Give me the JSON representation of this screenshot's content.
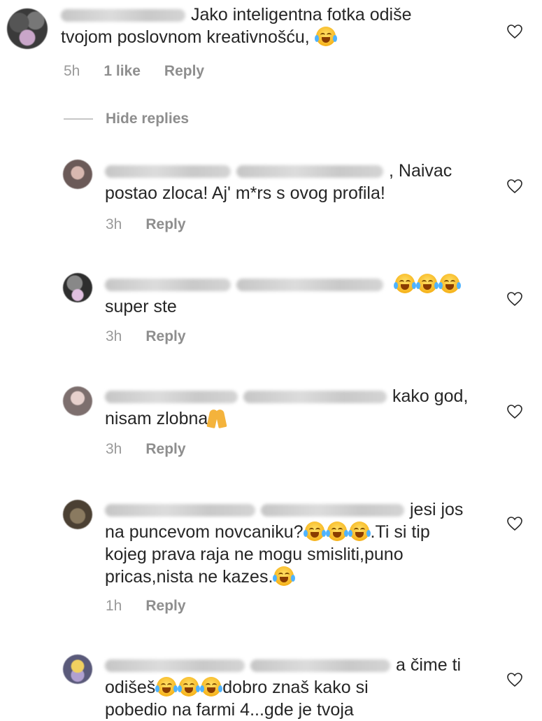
{
  "comments": [
    {
      "text_line1": "Jako inteligentna fotka odiše",
      "text_line2": "tvojom poslovnom kreativnošću,",
      "time": "5h",
      "likes": "1 like",
      "reply": "Reply"
    }
  ],
  "hide_replies": "Hide replies",
  "replies": [
    {
      "line1_tail": ", Naivac",
      "line2": "postao zloca! Aj' m*rs s ovog profila!",
      "time": "3h",
      "reply": "Reply"
    },
    {
      "line2": "super ste",
      "time": "3h",
      "reply": "Reply"
    },
    {
      "line1_tail": "kako god,",
      "line2": "nisam zlobna",
      "time": "3h",
      "reply": "Reply"
    },
    {
      "line1_tail": "jesi jos",
      "line2_a": "na puncevom novcaniku?",
      "line2_b": ".Ti si tip",
      "line3": "kojeg prava raja ne mogu smisliti,puno",
      "line4": "pricas,nista ne kazes.",
      "time": "1h",
      "reply": "Reply"
    },
    {
      "line1_tail": "a čime ti",
      "line2_a": "odišeš",
      "line2_b": "dobro znaš kako si",
      "line3": "pobedio na farmi 4...gde je tvoja"
    }
  ],
  "icons": {
    "like": "heart-outline-icon",
    "laugh": "face-with-tears-of-joy-icon",
    "pray": "folded-hands-icon"
  }
}
